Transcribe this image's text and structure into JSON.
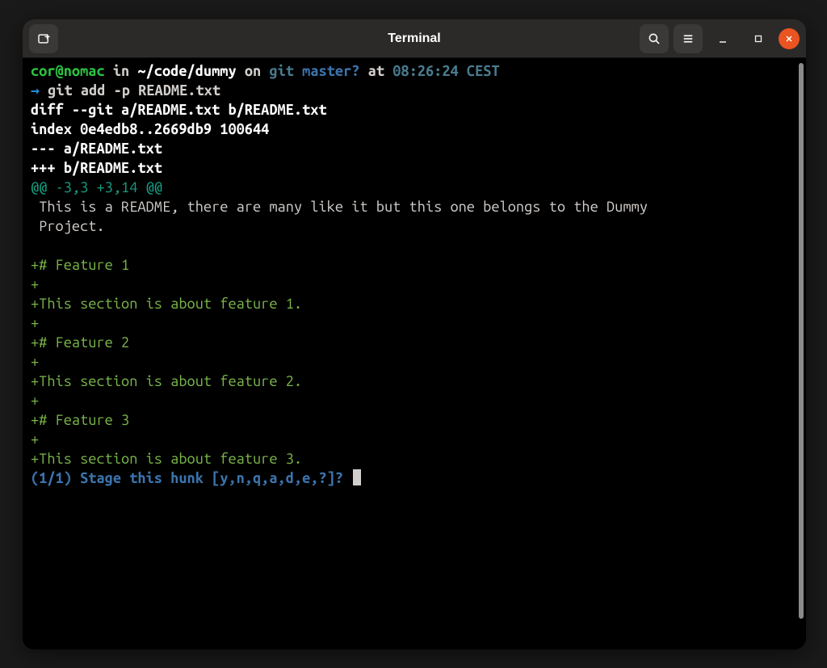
{
  "window": {
    "title": "Terminal"
  },
  "prompt": {
    "user_host": "cor@nomac",
    "sep_in": " in ",
    "path": "~/code/dummy",
    "sep_on": " on ",
    "git_label": "git ",
    "branch": "master",
    "dirty": "?",
    "sep_at": " at ",
    "time": "08:26:24 CEST",
    "arrow": "→ ",
    "command": "git add -p README.txt"
  },
  "diff": {
    "header1": "diff --git a/README.txt b/README.txt",
    "header2": "index 0e4edb8..2669db9 100644",
    "header3": "--- a/README.txt",
    "header4": "+++ b/README.txt",
    "hunk": "@@ -3,3 +3,14 @@",
    "ctx1": " This is a README, there are many like it but this one belongs to the Dummy",
    "ctx2": " Project.",
    "blank": "",
    "l1": "+# Feature 1",
    "l2": "+",
    "l3": "+This section is about feature 1.",
    "l4": "+",
    "l5": "+# Feature 2",
    "l6": "+",
    "l7": "+This section is about feature 2.",
    "l8": "+",
    "l9": "+# Feature 3",
    "l10": "+",
    "l11": "+This section is about feature 3."
  },
  "stage_prompt": "(1/1) Stage this hunk [y,n,q,a,d,e,?]? "
}
